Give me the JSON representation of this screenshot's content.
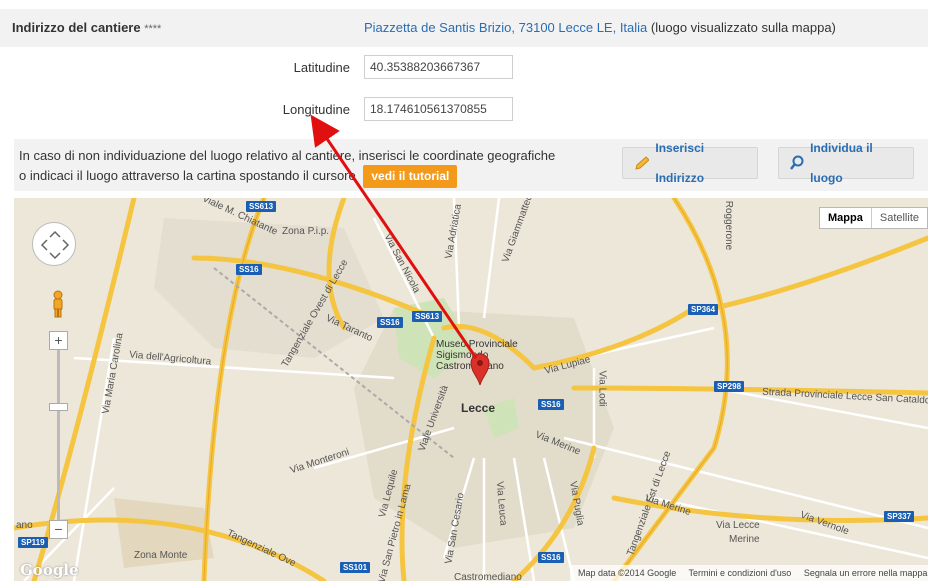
{
  "address": {
    "label": "Indirizzo del cantiere",
    "stars": "****",
    "link": "Piazzetta de Santis Brizio, 73100 Lecce LE, Italia",
    "note": "(luogo visualizzato sulla mappa)"
  },
  "coords": {
    "lat_label": "Latitudine",
    "lat_value": "40.35388203667367",
    "lng_label": "Longitudine",
    "lng_value": "18.174610561370855"
  },
  "info": {
    "line1": "In caso di non individuazione del luogo relativo al cantiere, inserisci le coordinate geografiche",
    "line2": "o indicaci il luogo attraverso la cartina spostando il cursore",
    "tutorial": "vedi il tutorial",
    "insert_button": "Inserisci Indirizzo",
    "locate_button": "Individua il luogo"
  },
  "map": {
    "type_map": "Mappa",
    "type_satellite": "Satellite",
    "city": "Lecce",
    "poi": "Museo Provinciale Sigismondo Castromediano",
    "logo": "Google",
    "footer_data": "Map data ©2014 Google",
    "footer_terms": "Termini e condizioni d'uso",
    "footer_report": "Segnala un errore nella mappa",
    "labels": [
      "Viale M. Chiatante",
      "Zona P.i.p.",
      "Via Adriatica",
      "Via Giammatteo",
      "Via San Nicola",
      "Tangenziale Ovest di Lecce",
      "Via Taranto",
      "Via dell'Agricoltura",
      "Via Maria Carolina",
      "Viale Università",
      "Via Lupiae",
      "Via Lodi",
      "Strada Provinciale Lecce San Cataldo",
      "Via Monteroni",
      "Via Merine",
      "Via Lequile",
      "Via San Pietro in Lama",
      "Via San Cesario",
      "Via Leuca",
      "Via Puglia",
      "Tangenziale Est di Lecce",
      "Via Merine",
      "Via Lecce",
      "Merine",
      "Via Vernole",
      "Zona Monte",
      "Castromediano",
      "Tangenziale Ove",
      "Roggerone",
      "ano"
    ],
    "badges": [
      "SS613",
      "SS16",
      "SS16",
      "SS613",
      "SS16",
      "SP364",
      "SP298",
      "SP337",
      "SP119",
      "SS101",
      "SS16"
    ]
  },
  "colors": {
    "link": "#2a6db3",
    "tutorial_bg": "#f39a1a",
    "arrow": "#e01010",
    "road_major": "#f5c542",
    "map_bg": "#ece7d9"
  }
}
